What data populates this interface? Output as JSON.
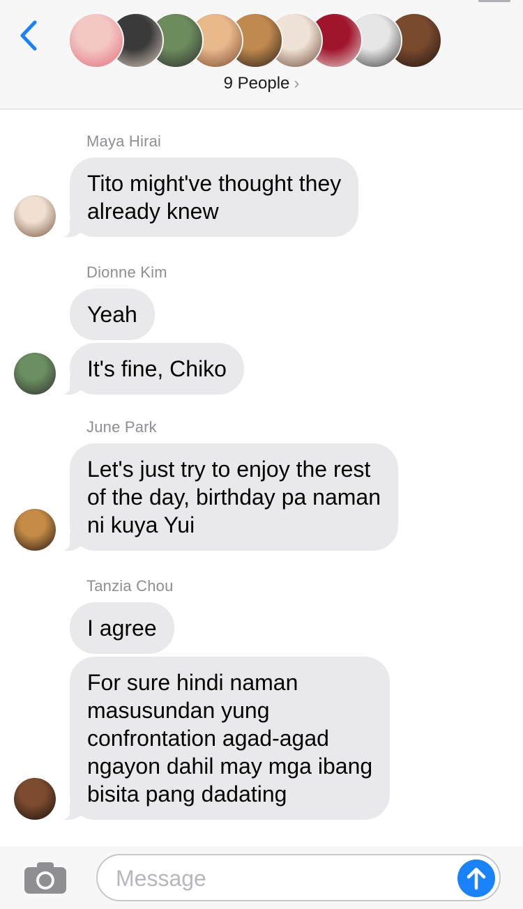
{
  "header": {
    "back_icon": "chevron-left-icon",
    "people_label": "9 People",
    "people_chevron": "›",
    "accent_color": "#1a82fb",
    "avatars": [
      {
        "name": "avatar-1",
        "colors": [
          "#f3c7c4",
          "#e36c7b"
        ]
      },
      {
        "name": "avatar-2",
        "colors": [
          "#3a3a3a",
          "#d9c8bd"
        ]
      },
      {
        "name": "avatar-3",
        "colors": [
          "#6c8c5e",
          "#2c2c2c"
        ]
      },
      {
        "name": "avatar-4",
        "colors": [
          "#e8b98b",
          "#7a4b2f"
        ]
      },
      {
        "name": "avatar-5",
        "colors": [
          "#c0894f",
          "#2a1d16"
        ]
      },
      {
        "name": "avatar-6",
        "colors": [
          "#efe2d6",
          "#6f4a35"
        ]
      },
      {
        "name": "avatar-7",
        "colors": [
          "#a0152c",
          "#e7d6d4"
        ]
      },
      {
        "name": "avatar-8",
        "colors": [
          "#e6e6e6",
          "#3d3d3d"
        ]
      },
      {
        "name": "avatar-9",
        "colors": [
          "#7a4a2e",
          "#1e1410"
        ]
      }
    ]
  },
  "messages": [
    {
      "sender": "Maya Hirai",
      "bubbles": [
        {
          "lines": [
            "Tito might've thought they",
            "already knew"
          ]
        }
      ],
      "avatar_colors": [
        "#f0e0d2",
        "#7b563f"
      ]
    },
    {
      "sender": "Dionne Kim",
      "bubbles": [
        {
          "lines": [
            "Yeah"
          ]
        },
        {
          "lines": [
            "It's fine, Chiko"
          ]
        }
      ],
      "avatar_colors": [
        "#6b8f60",
        "#2f2f2f"
      ]
    },
    {
      "sender": "June Park",
      "bubbles": [
        {
          "lines": [
            "Let's just try to enjoy the rest",
            "of the day, birthday pa naman",
            "ni kuya Yui"
          ]
        }
      ],
      "avatar_colors": [
        "#c58b46",
        "#241812"
      ]
    },
    {
      "sender": "Tanzia Chou",
      "bubbles": [
        {
          "lines": [
            "I agree"
          ]
        },
        {
          "lines": [
            "For sure hindi naman",
            "masusundan yung",
            "confrontation agad-agad",
            "ngayon dahil may mga ibang",
            "bisita pang dadating"
          ]
        }
      ],
      "avatar_colors": [
        "#7d4c30",
        "#1b110c"
      ]
    }
  ],
  "input": {
    "camera_icon": "camera-icon",
    "placeholder": "Message",
    "value": "",
    "send_icon": "arrow-up-icon"
  }
}
